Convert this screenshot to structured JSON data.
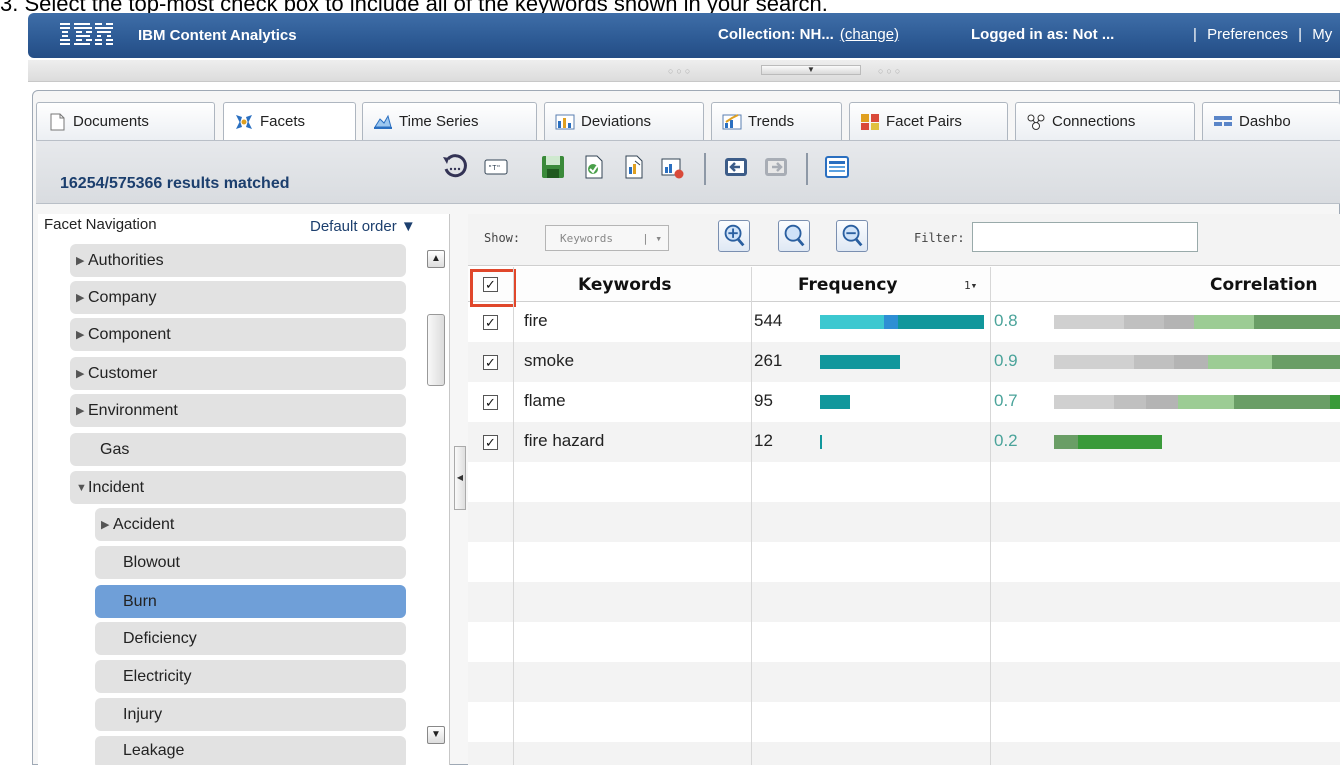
{
  "instruction": "3.  Select the top-most check box to include all of the keywords shown in your search.",
  "header": {
    "logo_text": "IBM",
    "app_name": "IBM Content Analytics",
    "collection_label": "Collection: NH...",
    "change_link": "(change)",
    "login_label": "Logged in as: Not ...",
    "sep1": "|",
    "preferences": "Preferences",
    "sep2": "|",
    "my": "My"
  },
  "tabs": [
    {
      "label": "Documents",
      "icon": "document-icon"
    },
    {
      "label": "Facets",
      "icon": "facets-icon"
    },
    {
      "label": "Time Series",
      "icon": "time-series-icon"
    },
    {
      "label": "Deviations",
      "icon": "deviations-icon"
    },
    {
      "label": "Trends",
      "icon": "trends-icon"
    },
    {
      "label": "Facet Pairs",
      "icon": "facet-pairs-icon"
    },
    {
      "label": "Connections",
      "icon": "connections-icon"
    },
    {
      "label": "Dashbo",
      "icon": "dashboard-icon"
    }
  ],
  "toolbar": {
    "results_text": "16254/575366 results matched"
  },
  "facet_panel": {
    "title": "Facet Navigation",
    "order": "Default order",
    "items": [
      {
        "label": "Authorities",
        "expander": "right"
      },
      {
        "label": "Company",
        "expander": "right"
      },
      {
        "label": "Component",
        "expander": "right"
      },
      {
        "label": "Customer",
        "expander": "right"
      },
      {
        "label": "Environment",
        "expander": "right"
      },
      {
        "label": "Gas",
        "expander": "none"
      },
      {
        "label": "Incident",
        "expander": "down"
      },
      {
        "label": "Accident",
        "expander": "right"
      },
      {
        "label": "Blowout",
        "expander": "none"
      },
      {
        "label": "Burn",
        "expander": "none",
        "selected": true
      },
      {
        "label": "Deficiency",
        "expander": "none"
      },
      {
        "label": "Electricity",
        "expander": "none"
      },
      {
        "label": "Injury",
        "expander": "none"
      },
      {
        "label": "Leakage",
        "expander": "none"
      }
    ]
  },
  "content": {
    "show_label": "Show:",
    "show_value": "Keywords",
    "filter_label": "Filter:",
    "filter_value": "",
    "columns": {
      "keywords": "Keywords",
      "frequency": "Frequency",
      "sort_indicator": "1▾",
      "correlation": "Correlation"
    },
    "rows": [
      {
        "keyword": "fire",
        "frequency": "544",
        "correlation": "0.8",
        "checked": true
      },
      {
        "keyword": "smoke",
        "frequency": "261",
        "correlation": "0.9",
        "checked": true
      },
      {
        "keyword": "flame",
        "frequency": "95",
        "correlation": "0.7",
        "checked": true
      },
      {
        "keyword": "fire hazard",
        "frequency": "12",
        "correlation": "0.2",
        "checked": true
      }
    ]
  },
  "colors": {
    "header_blue": "#2d5a94",
    "highlight_red": "#e0472b",
    "freq_bar": "#11979c",
    "freq_bar_light": "#3cc8d0",
    "selected_facet": "#6f9fd8"
  }
}
